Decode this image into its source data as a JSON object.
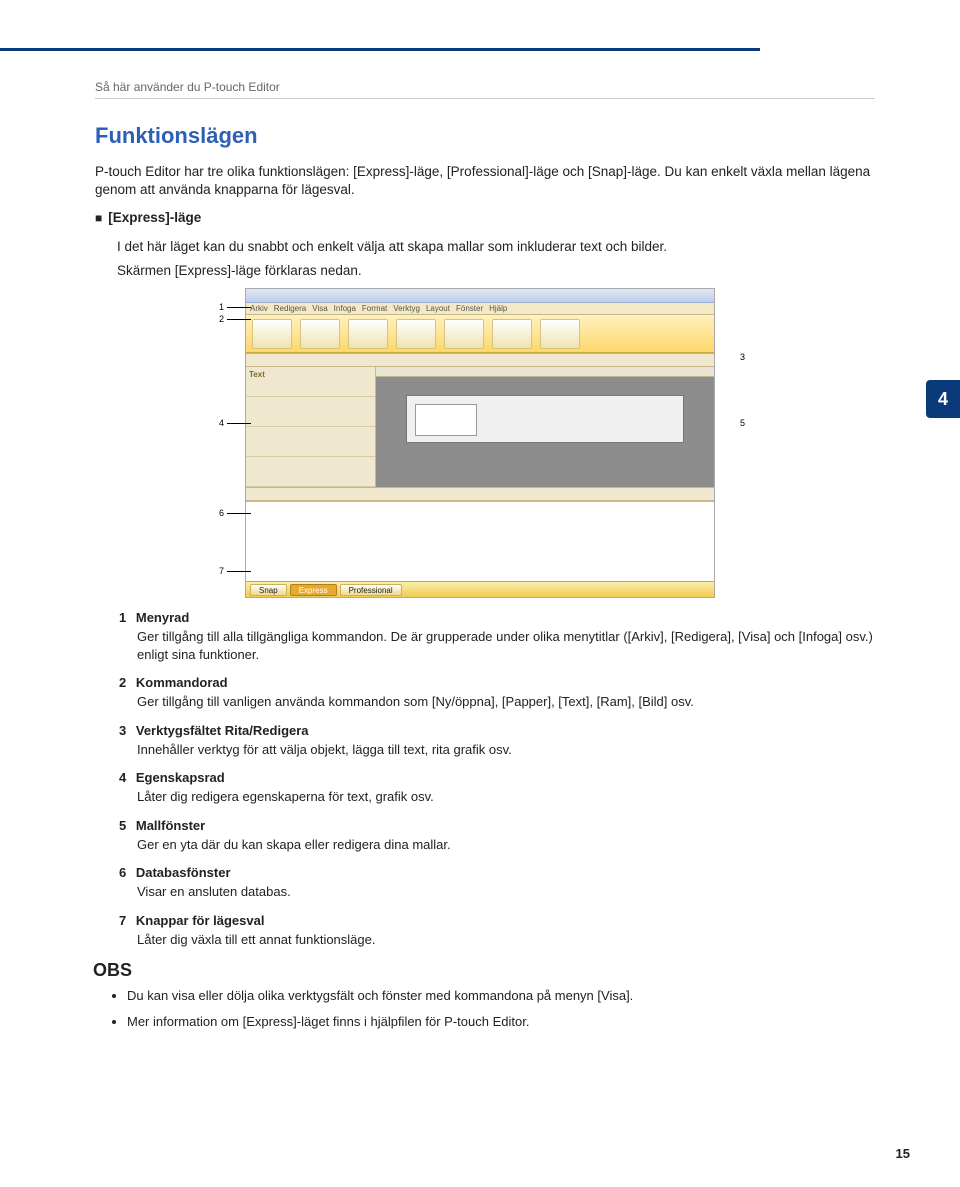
{
  "header": {
    "running": "Så här använder du P-touch Editor"
  },
  "title": "Funktionslägen",
  "intro": "P-touch Editor har tre olika funktionslägen: [Express]-läge, [Professional]-läge och [Snap]-läge. Du kan enkelt växla mellan lägena genom att använda knapparna för lägesval.",
  "express": {
    "heading": "[Express]-läge",
    "line1": "I det här läget kan du snabbt och enkelt välja att skapa mallar som inkluderar text och bilder.",
    "line2": "Skärmen [Express]-läge förklaras nedan."
  },
  "page_tab": "4",
  "screenshot": {
    "menubar": [
      "Arkiv",
      "Redigera",
      "Visa",
      "Infoga",
      "Format",
      "Verktyg",
      "Layout",
      "Fönster",
      "Hjälp"
    ],
    "modes": {
      "snap": "Snap",
      "express": "Express",
      "professional": "Professional"
    }
  },
  "callouts": {
    "c1": "1",
    "c2": "2",
    "c3": "3",
    "c4": "4",
    "c5": "5",
    "c6": "6",
    "c7": "7"
  },
  "items": [
    {
      "n": "1",
      "t": "Menyrad",
      "d": "Ger tillgång till alla tillgängliga kommandon. De är grupperade under olika menytitlar ([Arkiv], [Redigera], [Visa] och [Infoga] osv.) enligt sina funktioner."
    },
    {
      "n": "2",
      "t": "Kommandorad",
      "d": "Ger tillgång till vanligen använda kommandon som [Ny/öppna], [Papper], [Text], [Ram], [Bild] osv."
    },
    {
      "n": "3",
      "t": "Verktygsfältet Rita/Redigera",
      "d": "Innehåller verktyg för att välja objekt, lägga till text, rita grafik osv."
    },
    {
      "n": "4",
      "t": "Egenskapsrad",
      "d": "Låter dig redigera egenskaperna för text, grafik osv."
    },
    {
      "n": "5",
      "t": "Mallfönster",
      "d": "Ger en yta där du kan skapa eller redigera dina mallar."
    },
    {
      "n": "6",
      "t": "Databasfönster",
      "d": "Visar en ansluten databas."
    },
    {
      "n": "7",
      "t": "Knappar för lägesval",
      "d": "Låter dig växla till ett annat funktionsläge."
    }
  ],
  "obs": {
    "title": "OBS",
    "notes": [
      "Du kan visa eller dölja olika verktygsfält och fönster med kommandona på menyn [Visa].",
      "Mer information om [Express]-läget finns i hjälpfilen för P-touch Editor."
    ]
  },
  "page_number": "15"
}
